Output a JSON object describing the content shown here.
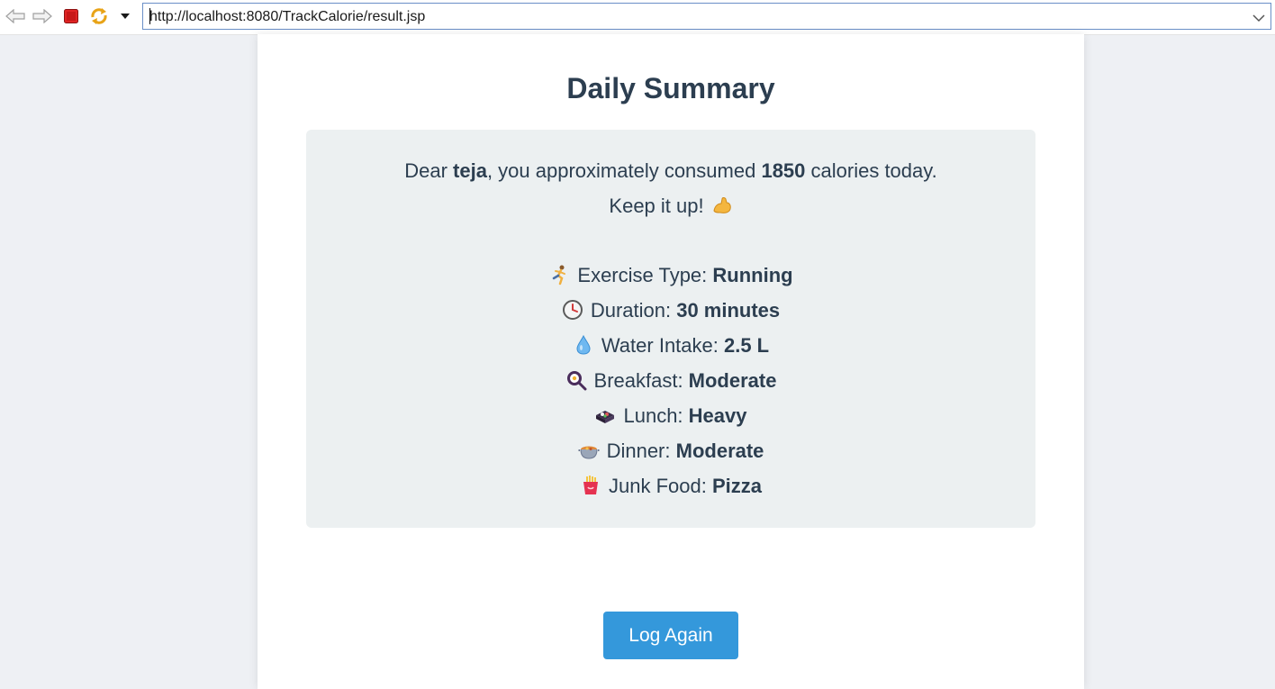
{
  "browser": {
    "url": "http://localhost:8080/TrackCalorie/result.jsp"
  },
  "page": {
    "title": "Daily Summary",
    "greeting": {
      "prefix": "Dear ",
      "name": "teja",
      "middle": ", you approximately consumed ",
      "calories": "1850",
      "suffix": " calories today."
    },
    "encouragement": "Keep it up!",
    "items": [
      {
        "label": "Exercise Type: ",
        "value": "Running",
        "icon": "runner-icon"
      },
      {
        "label": "Duration: ",
        "value": "30 minutes",
        "icon": "clock-icon"
      },
      {
        "label": "Water Intake: ",
        "value": "2.5 L",
        "icon": "water-drop-icon"
      },
      {
        "label": "Breakfast: ",
        "value": "Moderate",
        "icon": "frying-pan-egg-icon"
      },
      {
        "label": "Lunch: ",
        "value": "Heavy",
        "icon": "bento-box-icon"
      },
      {
        "label": "Dinner: ",
        "value": "Moderate",
        "icon": "stew-pot-icon"
      },
      {
        "label": "Junk Food: ",
        "value": "Pizza",
        "icon": "fries-icon"
      }
    ],
    "button_label": "Log Again"
  },
  "colors": {
    "title": "#2c3e50",
    "summary_bg": "#ecf0f1",
    "button": "#3498db"
  }
}
